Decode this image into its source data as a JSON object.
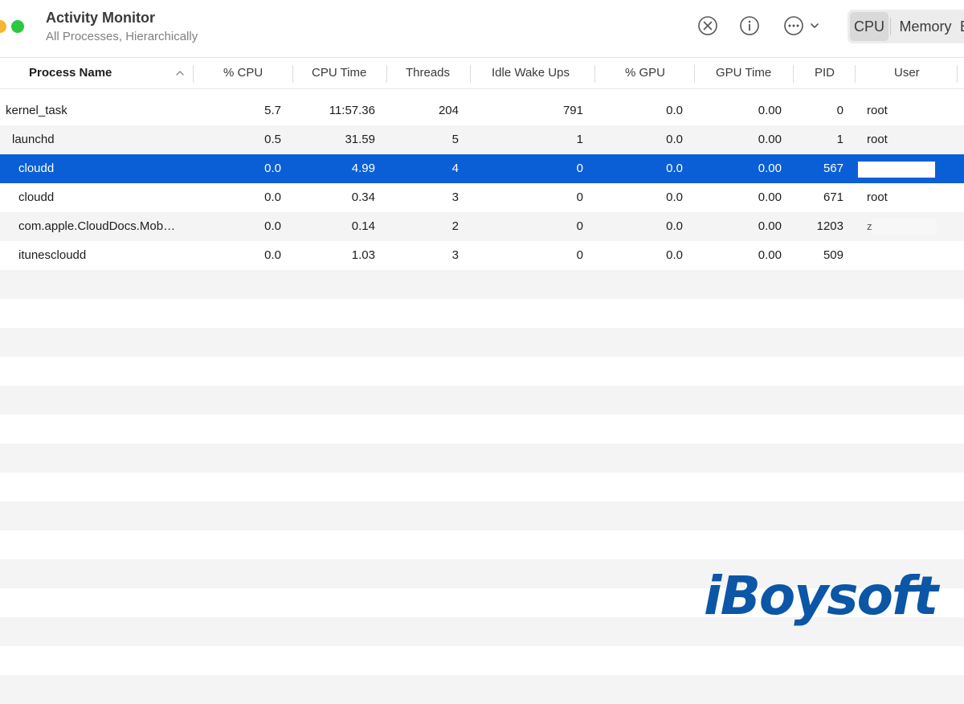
{
  "window": {
    "title": "Activity Monitor",
    "subtitle": "All Processes, Hierarchically"
  },
  "toolbar": {
    "icons": [
      "stop-process-icon",
      "info-icon",
      "more-options-icon",
      "chevron-down-icon"
    ],
    "tabs": [
      {
        "label": "CPU",
        "selected": true
      },
      {
        "label": "Memory",
        "selected": false
      },
      {
        "label": "E",
        "selected": false
      }
    ]
  },
  "table": {
    "columns": [
      "Process Name",
      "% CPU",
      "CPU Time",
      "Threads",
      "Idle Wake Ups",
      "% GPU",
      "GPU Time",
      "PID",
      "User"
    ],
    "sort_column": "Process Name",
    "rows": [
      {
        "name": "kernel_task",
        "cpu": "5.7",
        "cpu_time": "11:57.36",
        "threads": "204",
        "idle_wake_ups": "791",
        "gpu": "0.0",
        "gpu_time": "0.00",
        "pid": "0",
        "user": "root"
      },
      {
        "name": "launchd",
        "cpu": "0.5",
        "cpu_time": "31.59",
        "threads": "5",
        "idle_wake_ups": "1",
        "gpu": "0.0",
        "gpu_time": "0.00",
        "pid": "1",
        "user": "root"
      },
      {
        "name": "cloudd",
        "cpu": "0.0",
        "cpu_time": "4.99",
        "threads": "4",
        "idle_wake_ups": "0",
        "gpu": "0.0",
        "gpu_time": "0.00",
        "pid": "567",
        "user": ""
      },
      {
        "name": "cloudd",
        "cpu": "0.0",
        "cpu_time": "0.34",
        "threads": "3",
        "idle_wake_ups": "0",
        "gpu": "0.0",
        "gpu_time": "0.00",
        "pid": "671",
        "user": "root"
      },
      {
        "name": "com.apple.CloudDocs.Mob…",
        "cpu": "0.0",
        "cpu_time": "0.14",
        "threads": "2",
        "idle_wake_ups": "0",
        "gpu": "0.0",
        "gpu_time": "0.00",
        "pid": "1203",
        "user": "z"
      },
      {
        "name": "itunescloudd",
        "cpu": "0.0",
        "cpu_time": "1.03",
        "threads": "3",
        "idle_wake_ups": "0",
        "gpu": "0.0",
        "gpu_time": "0.00",
        "pid": "509",
        "user": ""
      }
    ]
  },
  "watermark": {
    "text": "iBoysoft",
    "color": "#0b56a6"
  },
  "colors": {
    "selection": "#0a5fd6",
    "row_alt": "#f4f4f5",
    "traffic_yellow": "#f6b62f",
    "traffic_green": "#2bc840"
  }
}
